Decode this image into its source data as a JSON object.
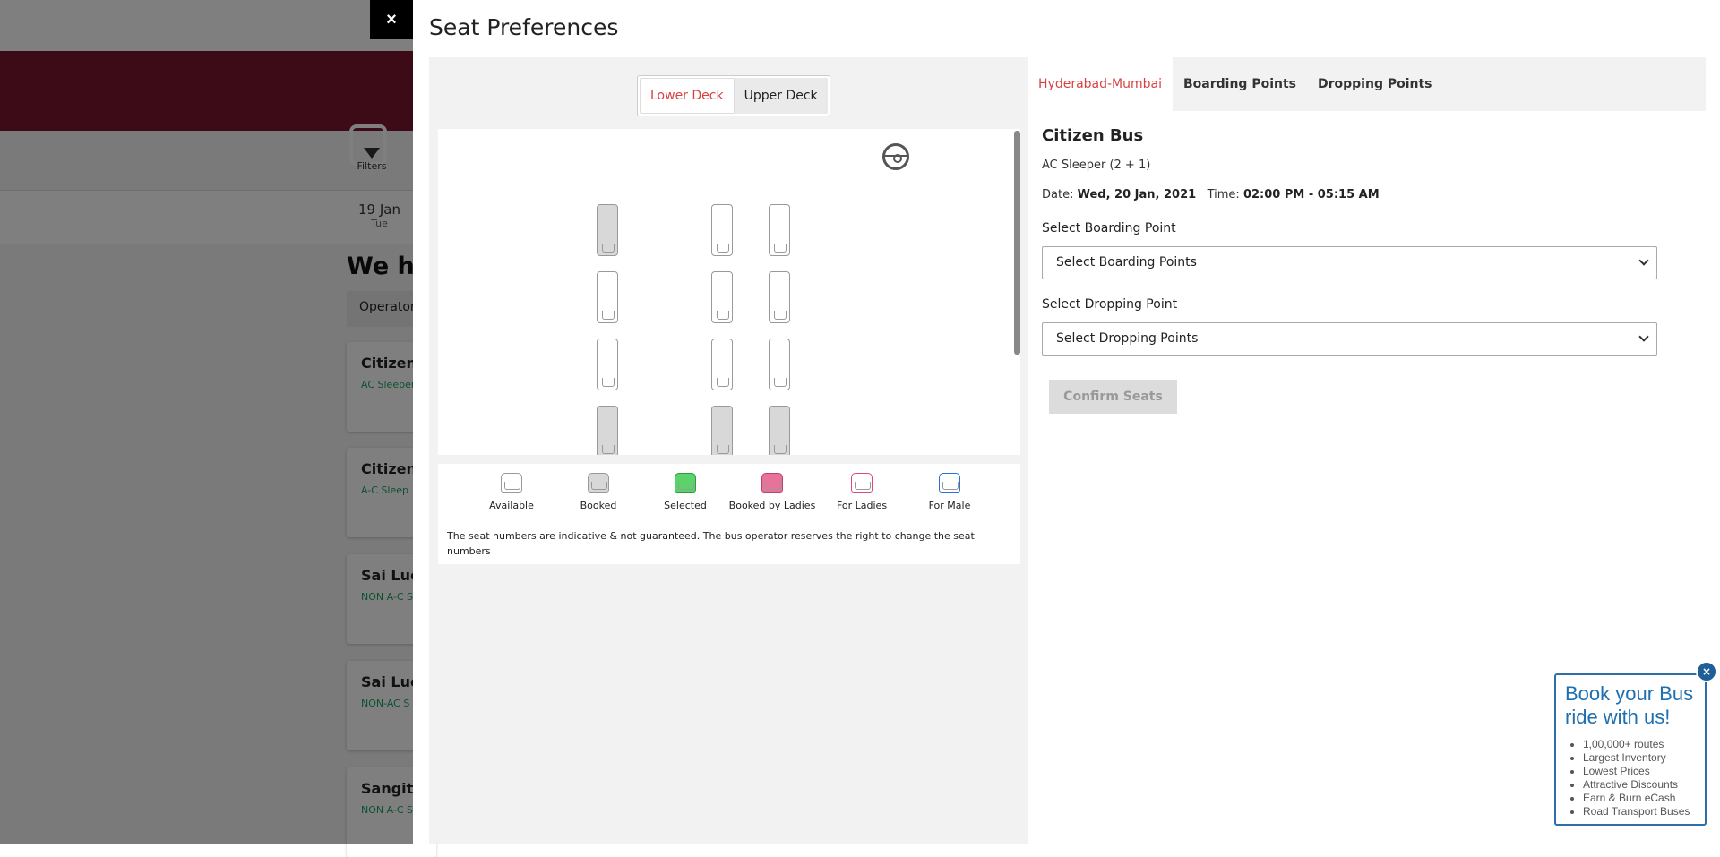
{
  "background": {
    "filters_label": "Filters",
    "date": "19 Jan",
    "day": "Tue",
    "heading": "We ha",
    "sort_label": "Operator",
    "cards": [
      {
        "name": "Citizen",
        "type": "AC Sleeper"
      },
      {
        "name": "Citizen",
        "type": "A-C Sleep"
      },
      {
        "name": "Sai Luck",
        "type": "NON A-C S"
      },
      {
        "name": "Sai Luck",
        "type": "NON-AC S"
      },
      {
        "name": "Sangita",
        "type": "NON A-C S"
      }
    ]
  },
  "modal": {
    "close_label": "×",
    "title": "Seat Preferences",
    "deck": {
      "lower": "Lower Deck",
      "upper": "Upper Deck",
      "selected": "lower"
    },
    "legend": {
      "items": [
        {
          "label": "Available",
          "color": "#ffffff",
          "border": "#999999"
        },
        {
          "label": "Booked",
          "color": "#d8d8d8",
          "border": "#999999"
        },
        {
          "label": "Selected",
          "color": "#59d36a",
          "border": "#2f9a3e"
        },
        {
          "label": "Booked by Ladies",
          "color": "#e8729a",
          "border": "#b8446a"
        },
        {
          "label": "For Ladies",
          "color": "#ffffff",
          "border": "#e0487a"
        },
        {
          "label": "For Male",
          "color": "#ffffff",
          "border": "#2f6fd8"
        }
      ],
      "note": "The seat numbers are indicative & not guaranteed. The bus operator reserves the right to change the seat numbers"
    },
    "tabs": [
      "Hyderabad-Mumbai",
      "Boarding Points",
      "Dropping Points"
    ],
    "bus": {
      "name": "Citizen Bus",
      "type": "AC Sleeper (2 + 1)",
      "date_label": "Date:",
      "date": "Wed, 20 Jan, 2021",
      "time_label": "Time:",
      "time": "02:00 PM - 05:15 AM"
    },
    "boarding": {
      "label": "Select Boarding Point",
      "value": "Select Boarding Points"
    },
    "dropping": {
      "label": "Select Dropping Point",
      "value": "Select Dropping Points"
    },
    "confirm_label": "Confirm Seats"
  },
  "promo": {
    "close_label": "×",
    "title": "Book your Bus ride with us!",
    "items": [
      "1,00,000+ routes",
      "Largest Inventory",
      "Lowest Prices",
      "Attractive Discounts",
      "Earn & Burn eCash",
      "Road Transport Buses"
    ]
  }
}
